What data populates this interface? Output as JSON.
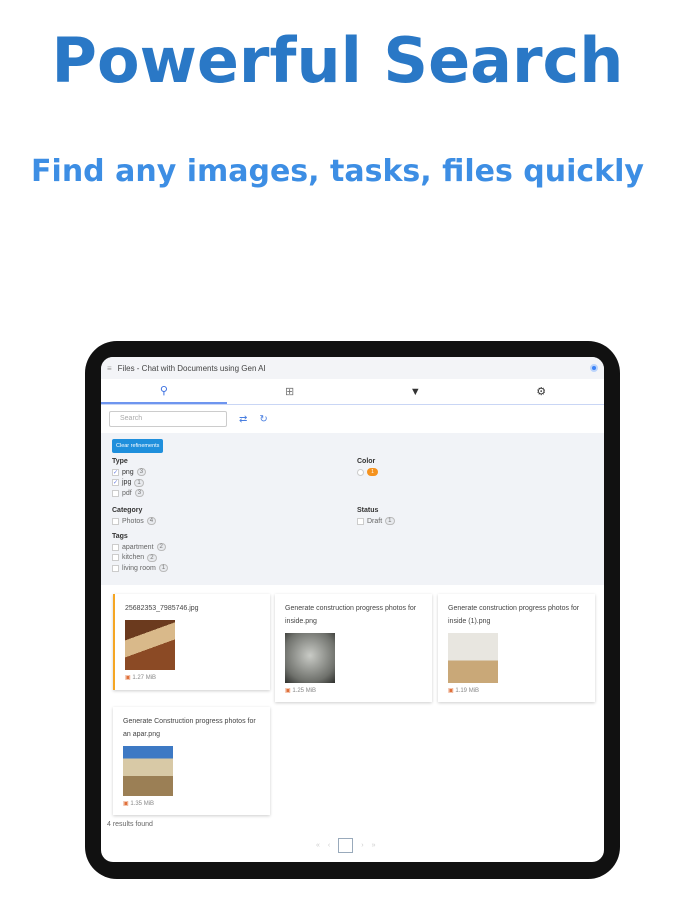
{
  "headline": "Powerful Search",
  "subheadline": "Find any images, tasks, files quickly",
  "app": {
    "title": "Files - Chat with Documents using Gen AI",
    "tabs": [
      "search",
      "grid",
      "filter",
      "settings"
    ],
    "search_placeholder": "Search",
    "clear_label": "Clear refinements",
    "type": {
      "label": "Type",
      "options": [
        {
          "name": "png",
          "count": "3",
          "checked": true
        },
        {
          "name": "jpg",
          "count": "1",
          "checked": true
        },
        {
          "name": "pdf",
          "count": "3",
          "checked": false
        }
      ]
    },
    "color": {
      "label": "Color",
      "swatch_count": "1",
      "swatch_color": "#f5921e"
    },
    "category": {
      "label": "Category",
      "options": [
        {
          "name": "Photos",
          "count": "4"
        }
      ]
    },
    "status": {
      "label": "Status",
      "options": [
        {
          "name": "Draft",
          "count": "1"
        }
      ]
    },
    "tags": {
      "label": "Tags",
      "options": [
        {
          "name": "apartment",
          "count": "2"
        },
        {
          "name": "kitchen",
          "count": "2"
        },
        {
          "name": "living room",
          "count": "1"
        }
      ]
    },
    "files": [
      {
        "name": "25682353_7985746.jpg",
        "size": "1.27 MiB"
      },
      {
        "name": "Generate construction progress photos for inside.png",
        "size": "1.25 MiB"
      },
      {
        "name": "Generate construction progress photos for inside (1).png",
        "size": "1.19 MiB"
      },
      {
        "name": "Generate Construction progress photos for an apar.png",
        "size": "1.35 MiB"
      }
    ],
    "results": "4 results found"
  }
}
